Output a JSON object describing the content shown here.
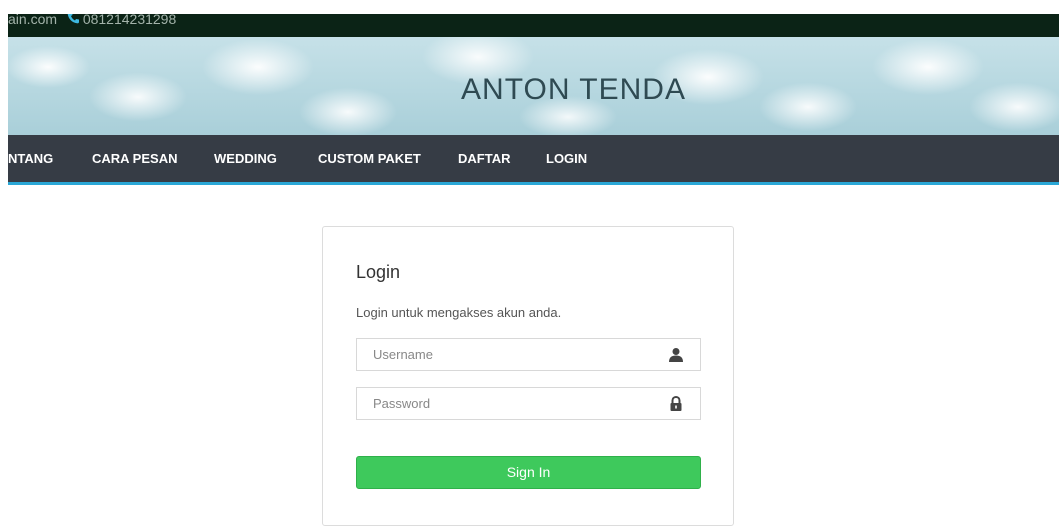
{
  "topbar": {
    "email_fragment": "ain.com",
    "phone_icon": "phone-icon",
    "phone": "081214231298"
  },
  "banner": {
    "title": "ANTON TENDA"
  },
  "nav": {
    "items": [
      "NTANG",
      "CARA PESAN",
      "WEDDING",
      "CUSTOM PAKET",
      "DAFTAR",
      "LOGIN"
    ]
  },
  "login": {
    "title": "Login",
    "subtitle": "Login untuk mengakses akun anda.",
    "username_placeholder": "Username",
    "username_icon": "user-icon",
    "password_placeholder": "Password",
    "password_icon": "lock-icon",
    "submit_label": "Sign In"
  },
  "colors": {
    "topbar_bg": "#0b2316",
    "navbar_bg": "#363c45",
    "nav_accent": "#2aa7d6",
    "button_green": "#3ec95c"
  }
}
